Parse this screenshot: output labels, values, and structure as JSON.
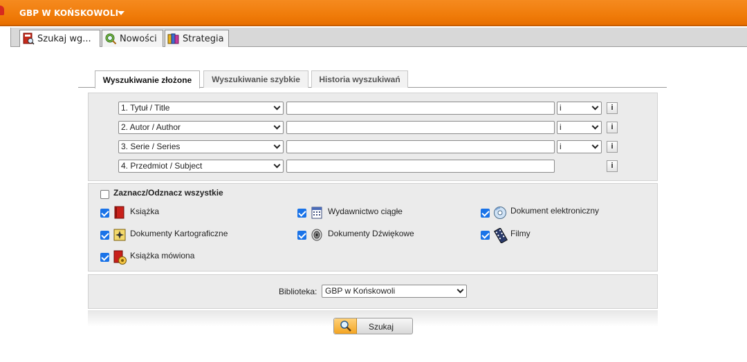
{
  "header": {
    "library_title": "GBP W KOŃSKOWOLI"
  },
  "app_tabs": [
    {
      "label": "Szukaj wg...",
      "icon": "search-book-icon"
    },
    {
      "label": "Nowości",
      "icon": "magnifier-globe-icon"
    },
    {
      "label": "Strategia",
      "icon": "books-stack-icon"
    }
  ],
  "search_tabs": [
    {
      "label": "Wyszukiwanie złożone",
      "active": true
    },
    {
      "label": "Wyszukiwanie szybkie",
      "active": false
    },
    {
      "label": "Historia wyszukiwań",
      "active": false
    }
  ],
  "criteria": [
    {
      "field": "1. Tytuł / Title",
      "value": "",
      "operator": "i",
      "info": "i"
    },
    {
      "field": "2. Autor / Author",
      "value": "",
      "operator": "i",
      "info": "i"
    },
    {
      "field": "3. Serie / Series",
      "value": "",
      "operator": "i",
      "info": "i"
    },
    {
      "field": "4. Przedmiot / Subject",
      "value": "",
      "operator": "",
      "info": "i"
    }
  ],
  "material_types": {
    "select_all_label": "Zaznacz/Odznacz wszystkie",
    "select_all_checked": false,
    "items": [
      {
        "label": "Książka",
        "checked": true,
        "icon": "book-icon"
      },
      {
        "label": "Wydawnictwo ciągłe",
        "checked": true,
        "icon": "calendar-icon"
      },
      {
        "label": "Dokument elektroniczny",
        "checked": true,
        "icon": "cd-disc-icon"
      },
      {
        "label": "Dokumenty Kartograficzne",
        "checked": true,
        "icon": "compass-map-icon"
      },
      {
        "label": "Dokumenty Dźwiękowe",
        "checked": true,
        "icon": "speaker-icon"
      },
      {
        "label": "Filmy",
        "checked": true,
        "icon": "film-strip-icon"
      },
      {
        "label": "Książka mówiona",
        "checked": true,
        "icon": "audiobook-icon"
      }
    ]
  },
  "library": {
    "label": "Biblioteka:",
    "selected": "GBP w Końskowoli"
  },
  "search_button": {
    "label": "Szukaj",
    "icon": "magnifier-icon"
  },
  "colors": {
    "accent_orange": "#f07c0a",
    "checkbox_blue": "#1a73e8",
    "panel_gray": "#ebebeb"
  }
}
